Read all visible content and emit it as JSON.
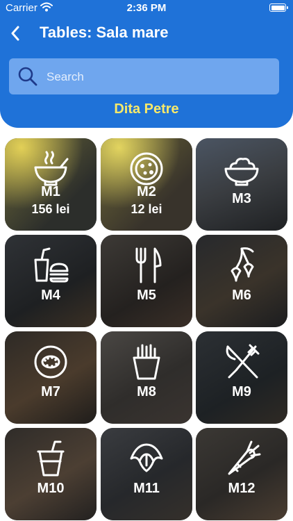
{
  "status_bar": {
    "carrier": "Carrier",
    "time": "2:36 PM"
  },
  "header": {
    "title": "Tables: Sala mare",
    "search_placeholder": "Search",
    "waiter_name": "Dita Petre"
  },
  "colors": {
    "header_blue": "#1f72d8",
    "search_bg": "#6fa6ee",
    "waiter_name_yellow": "#f7e96a",
    "occupied_highlight": "#e7d64a"
  },
  "tables": [
    {
      "name": "M1",
      "total": "156 lei",
      "icon": "soup-bowl-icon",
      "occupied": true
    },
    {
      "name": "M2",
      "total": "12 lei",
      "icon": "pizza-icon",
      "occupied": true
    },
    {
      "name": "M3",
      "total": "",
      "icon": "salad-bowl-icon",
      "occupied": false
    },
    {
      "name": "M4",
      "total": "",
      "icon": "burger-drink-icon",
      "occupied": false
    },
    {
      "name": "M5",
      "total": "",
      "icon": "fork-knife-icon",
      "occupied": false
    },
    {
      "name": "M6",
      "total": "",
      "icon": "cherries-icon",
      "occupied": false
    },
    {
      "name": "M7",
      "total": "",
      "icon": "kiwi-icon",
      "occupied": false
    },
    {
      "name": "M8",
      "total": "",
      "icon": "fries-icon",
      "occupied": false
    },
    {
      "name": "M9",
      "total": "",
      "icon": "crossed-utensils-icon",
      "occupied": false
    },
    {
      "name": "M10",
      "total": "",
      "icon": "cup-straw-icon",
      "occupied": false
    },
    {
      "name": "M11",
      "total": "",
      "icon": "croissant-icon",
      "occupied": false
    },
    {
      "name": "M12",
      "total": "",
      "icon": "carrot-icon",
      "occupied": false
    }
  ]
}
